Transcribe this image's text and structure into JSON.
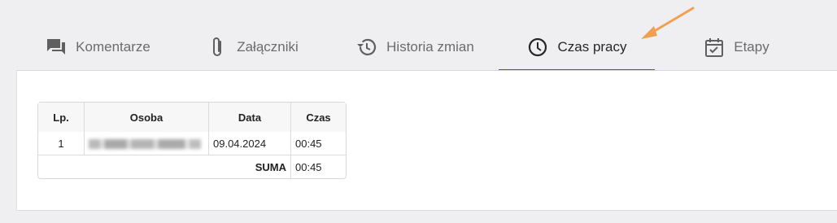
{
  "tabs": [
    {
      "label": "Komentarze",
      "icon": "comments-icon",
      "active": false
    },
    {
      "label": "Załączniki",
      "icon": "paperclip-icon",
      "active": false
    },
    {
      "label": "Historia zmian",
      "icon": "history-icon",
      "active": false
    },
    {
      "label": "Czas pracy",
      "icon": "clock-icon",
      "active": true
    },
    {
      "label": "Etapy",
      "icon": "calendar-check-icon",
      "active": false
    }
  ],
  "table": {
    "headers": [
      "Lp.",
      "Osoba",
      "Data",
      "Czas"
    ],
    "rows": [
      {
        "lp": "1",
        "osoba": "(blurred name)",
        "data": "09.04.2024",
        "czas": "00:45"
      }
    ],
    "summary": {
      "label": "SUMA",
      "value": "00:45"
    }
  },
  "colors": {
    "accent": "#5b4fbf",
    "arrow": "#f0a050"
  }
}
